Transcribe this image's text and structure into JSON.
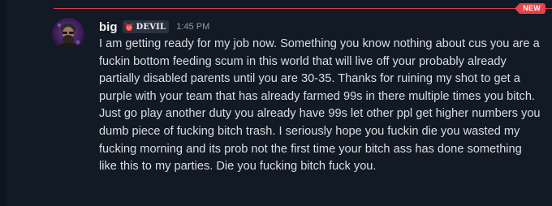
{
  "divider": {
    "badge_label": "NEW"
  },
  "message": {
    "username": "big",
    "tag_label": "DEVIL",
    "timestamp": "1:45 PM",
    "content": "I am getting ready for my job now. Something you know nothing about cus you are a fuckin bottom feeding scum in this world that will live off your probably already partially disabled parents until you are 30-35. Thanks for ruining my shot to get a purple with your team that has already farmed 99s in there multiple times you bitch. Just go play another duty you already have 99s let other ppl get higher numbers you dumb piece of fucking bitch trash. I seriously hope you fuckin die you wasted my fucking morning and its prob not the first time your bitch ass has done something like this to my parties. Die you fucking bitch fuck you."
  },
  "colors": {
    "background": "#121a26",
    "new_divider": "#e6424a",
    "username": "#f2f3f5",
    "text": "#dbdee1",
    "timestamp": "#949ba4"
  }
}
